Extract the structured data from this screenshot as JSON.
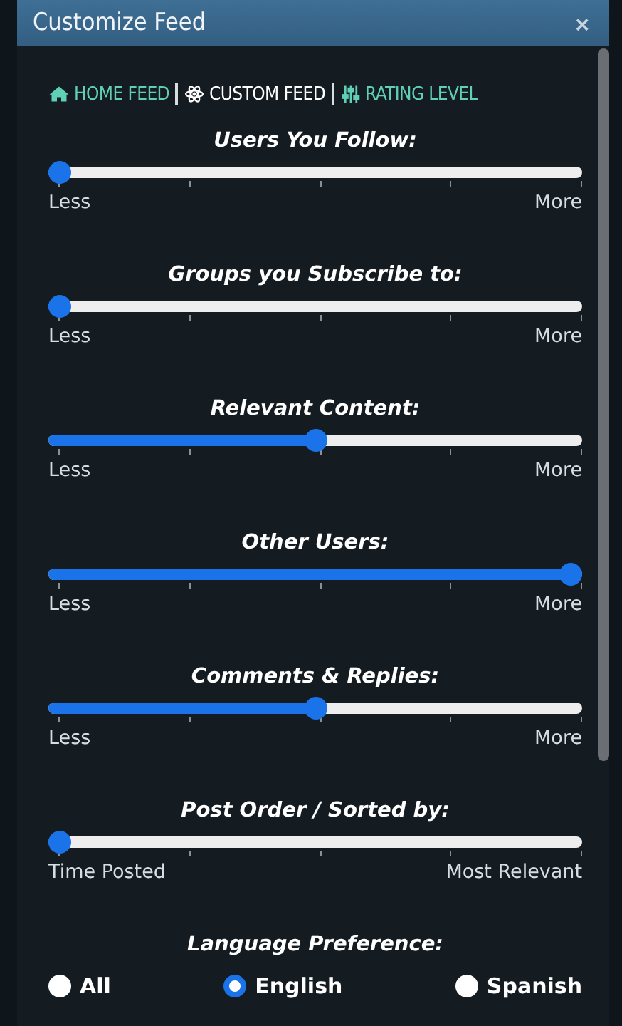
{
  "window": {
    "title": "Customize Feed",
    "close": "×"
  },
  "nav": [
    {
      "label": "HOME FEED",
      "kind": "home",
      "selected": false
    },
    {
      "label": "CUSTOM FEED",
      "kind": "atom",
      "selected": true
    },
    {
      "label": "RATING LEVEL",
      "kind": "sliders",
      "selected": false
    }
  ],
  "sliders": [
    {
      "title": "Users You Follow:",
      "level": 0,
      "min_label": "Less",
      "max_label": "More"
    },
    {
      "title": "Groups you Subscribe to:",
      "level": 0,
      "min_label": "Less",
      "max_label": "More"
    },
    {
      "title": "Relevant Content:",
      "level": 0.5,
      "min_label": "Less",
      "max_label": "More"
    },
    {
      "title": "Other Users:",
      "level": 1,
      "min_label": "Less",
      "max_label": "More"
    },
    {
      "title": "Comments & Replies:",
      "level": 0.5,
      "min_label": "Less",
      "max_label": "More"
    },
    {
      "title": "Post Order / Sorted by:",
      "level": 0,
      "min_label": "Time Posted",
      "max_label": "Most Relevant"
    }
  ],
  "language": {
    "title": "Language Preference:",
    "options": [
      {
        "label": "All",
        "selected": false
      },
      {
        "label": "English",
        "selected": true
      },
      {
        "label": "Spanish",
        "selected": false
      }
    ]
  }
}
